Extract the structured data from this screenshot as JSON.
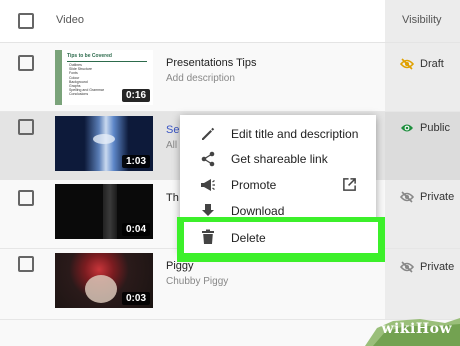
{
  "header": {
    "video_label": "Video",
    "visibility_label": "Visibility"
  },
  "rows": [
    {
      "title": "Presentations Tips",
      "description": "Add description",
      "duration": "0:16",
      "visibility": "Draft",
      "thumb_slide_title": "Tips to be Covered",
      "thumb_bullets": [
        "Outlines",
        "Slide Structure",
        "Fonts",
        "Colour",
        "Background",
        "Graphs",
        "Spelling and Grammar",
        "Conclusions"
      ]
    },
    {
      "title": "Se",
      "description": "All",
      "duration": "1:03",
      "visibility": "Public"
    },
    {
      "title": "Th",
      "description": "",
      "duration": "0:04",
      "visibility": "Private"
    },
    {
      "title": "Piggy",
      "description": "Chubby Piggy",
      "duration": "0:03",
      "visibility": "Private"
    }
  ],
  "menu": {
    "items": [
      {
        "label": "Edit title and description",
        "icon": "pencil-icon"
      },
      {
        "label": "Get shareable link",
        "icon": "share-icon"
      },
      {
        "label": "Promote",
        "icon": "megaphone-icon",
        "trailing_icon": "external-link-icon"
      },
      {
        "label": "Download",
        "icon": "download-icon"
      },
      {
        "label": "Delete",
        "icon": "trash-icon"
      }
    ]
  },
  "watermark": {
    "text": "wikiHow"
  },
  "colors": {
    "highlight": "#3cf02a",
    "draft_icon": "#e0a100",
    "public_icon": "#1e8e3e",
    "link_text": "#3a55c4"
  }
}
